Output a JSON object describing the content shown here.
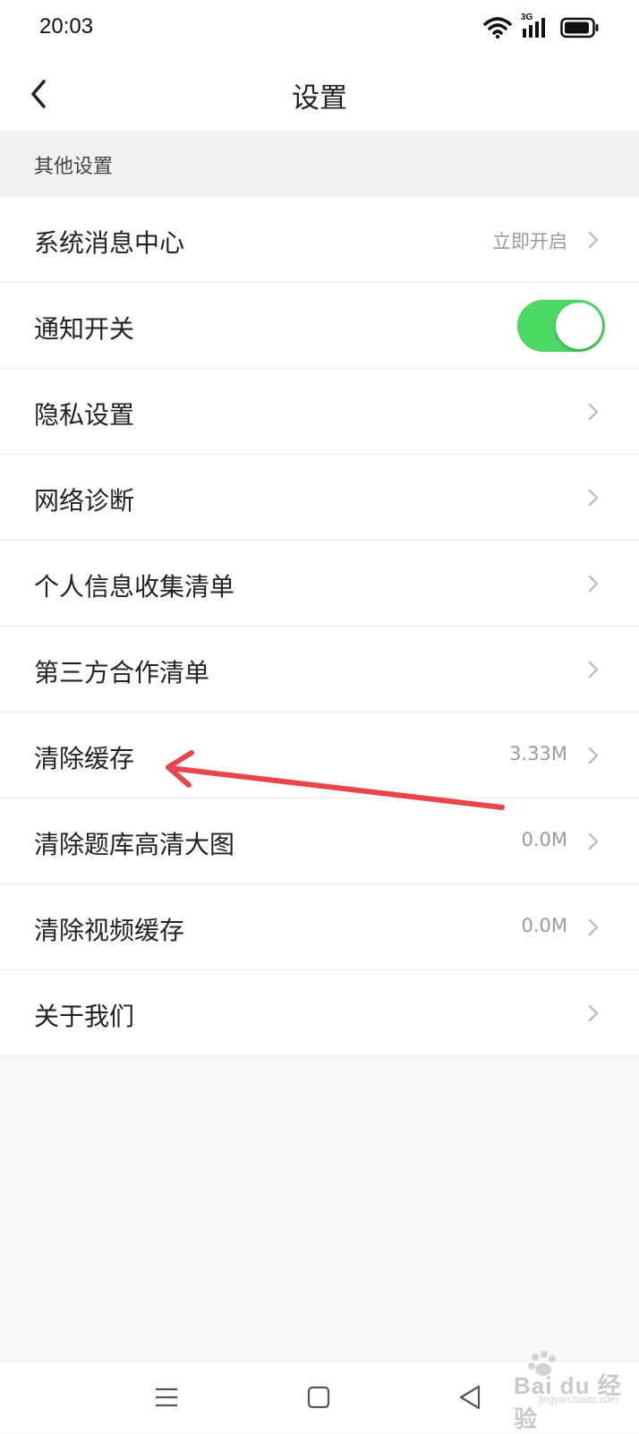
{
  "status_bar": {
    "time": "20:03",
    "network": "3G",
    "icons": [
      "wifi-icon",
      "signal-icon",
      "battery-icon"
    ]
  },
  "header": {
    "title": "设置",
    "back_icon": "chevron-left-icon"
  },
  "section": {
    "title": "其他设置"
  },
  "rows": [
    {
      "label": "系统消息中心",
      "value": "立即开启",
      "chevron": true
    },
    {
      "label": "通知开关",
      "toggle_on": true
    },
    {
      "label": "隐私设置",
      "value": "",
      "chevron": true
    },
    {
      "label": "网络诊断",
      "value": "",
      "chevron": true
    },
    {
      "label": "个人信息收集清单",
      "value": "",
      "chevron": true
    },
    {
      "label": "第三方合作清单",
      "value": "",
      "chevron": true
    },
    {
      "label": "清除缓存",
      "value": "3.33M",
      "chevron": true
    },
    {
      "label": "清除题库高清大图",
      "value": "0.0M",
      "chevron": true
    },
    {
      "label": "清除视频缓存",
      "value": "0.0M",
      "chevron": true
    },
    {
      "label": "关于我们",
      "value": "",
      "chevron": true
    }
  ],
  "colors": {
    "toggle_on": "#4cd964",
    "annotation_arrow": "#e8464a",
    "background": "#f7f7f7"
  },
  "nav_bar": {
    "icons": [
      "menu-icon",
      "home-square-icon",
      "back-triangle-icon"
    ]
  },
  "watermark": {
    "text": "Bai du 经验",
    "sub": "jingyan.baidu.com"
  }
}
